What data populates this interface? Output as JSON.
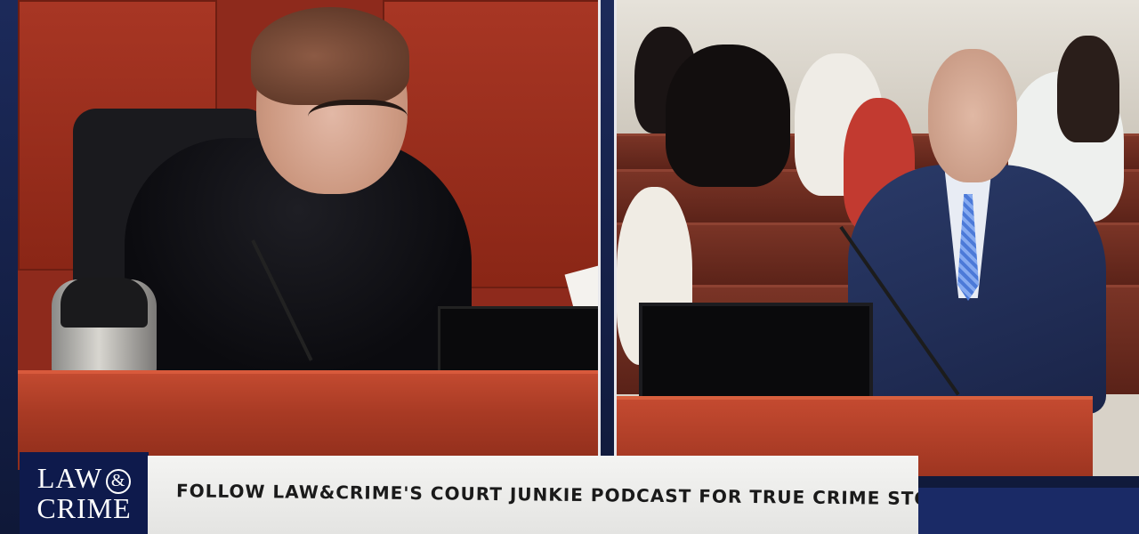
{
  "logo": {
    "line1": "LAW",
    "amp": "&",
    "line2": "CRIME"
  },
  "ticker": {
    "text": "FOLLOW LAW&CRIME'S COURT JUNKIE  PODCAST FOR TRUE CRIME STORIES"
  },
  "colors": {
    "brand_navy": "#0e1a4c",
    "banner_bg": "#f0f0ee",
    "bench_red": "#b8442c"
  }
}
